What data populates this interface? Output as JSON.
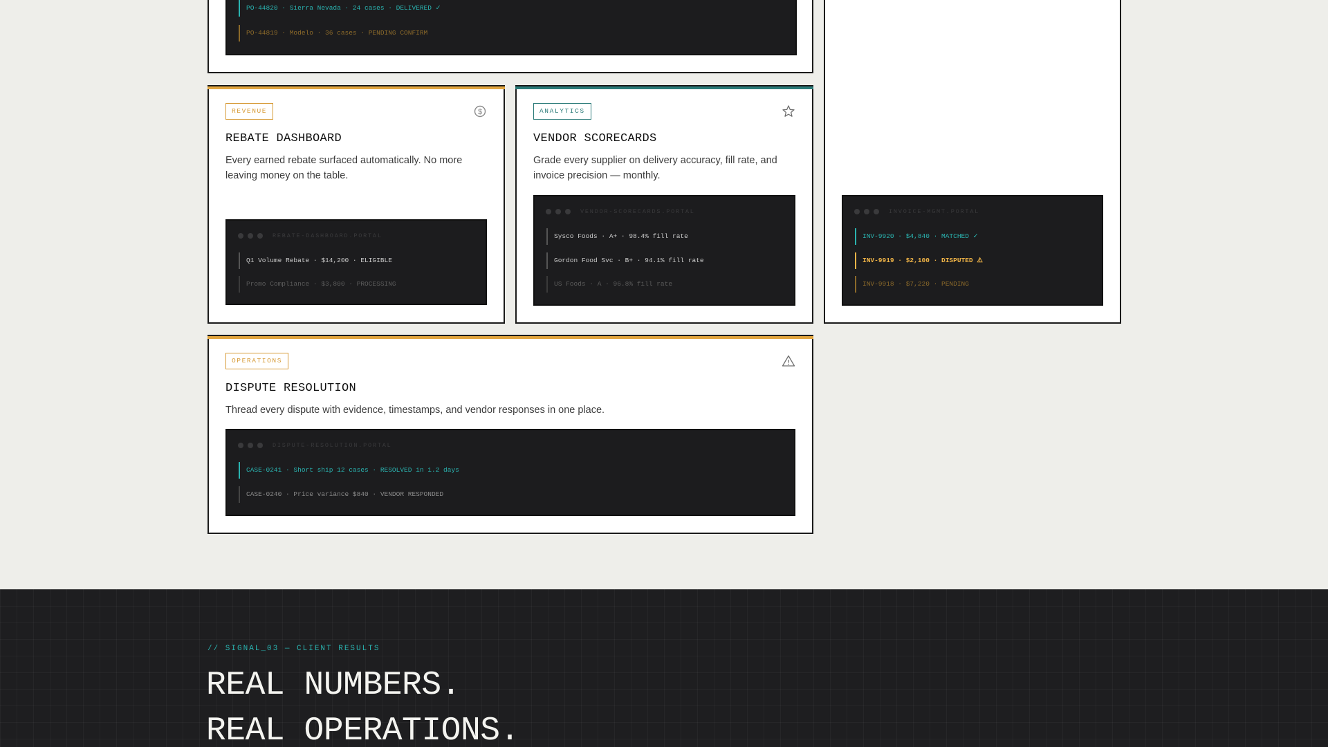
{
  "top_card": {
    "lines": [
      "PO-44820 · Sierra Nevada · 24 cases · DELIVERED ✓",
      "PO-44819 · Modelo · 36 cases · PENDING CONFIRM"
    ]
  },
  "cards": {
    "rebate": {
      "tag": "REVENUE",
      "icon": "dollar-circle-icon",
      "title": "REBATE DASHBOARD",
      "description": "Every earned rebate surfaced automatically. No more leaving money on the table.",
      "terminal_label": "REBATE-DASHBOARD.PORTAL",
      "lines": [
        "Q1 Volume Rebate · $14,200 · ELIGIBLE",
        "Promo Compliance · $3,800 · PROCESSING"
      ]
    },
    "vendor": {
      "tag": "ANALYTICS",
      "icon": "star-icon",
      "title": "VENDOR SCORECARDS",
      "description": "Grade every supplier on delivery accuracy, fill rate, and invoice precision — monthly.",
      "terminal_label": "VENDOR-SCORECARDS.PORTAL",
      "lines": [
        "Sysco Foods · A+ · 98.4% fill rate",
        "Gordon Food Svc · B+ · 94.1% fill rate",
        "US Foods · A · 96.8% fill rate"
      ]
    },
    "invoice": {
      "terminal_label": "INVOICE-MGMT.PORTAL",
      "lines": [
        "INV-9920 · $4,840 · MATCHED ✓",
        "INV-9919 · $2,100 · DISPUTED ⚠",
        "INV-9918 · $7,220 · PENDING"
      ]
    },
    "dispute": {
      "tag": "OPERATIONS",
      "icon": "warning-triangle-icon",
      "title": "DISPUTE RESOLUTION",
      "description": "Thread every dispute with evidence, timestamps, and vendor responses in one place.",
      "terminal_label": "DISPUTE-RESOLUTION.PORTAL",
      "lines": [
        "CASE-0241 · Short ship 12 cases · RESOLVED in 1.2 days",
        "CASE-0240 · Price variance $840 · VENDOR RESPONDED"
      ]
    }
  },
  "footer": {
    "kicker": "// SIGNAL_03 — CLIENT RESULTS",
    "headline_line1": "REAL NUMBERS.",
    "headline_line2": "REAL OPERATIONS."
  },
  "colors": {
    "gold": "#e2a640",
    "teal": "#2a7a78",
    "accent_teal": "#2ab3b0",
    "dark": "#1c1c1e",
    "page_bg": "#eeeeea"
  }
}
